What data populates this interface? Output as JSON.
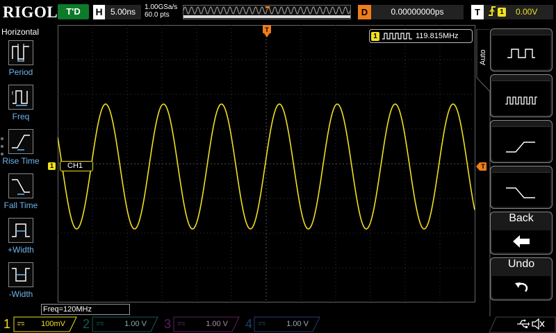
{
  "top": {
    "logo": "RIGOL",
    "run_status": "T'D",
    "h_badge": "H",
    "timebase": "5.00ns",
    "sample_rate": "1.00GSa/s",
    "memory_depth": "60.0 pts",
    "memory_trigger_badge": "T",
    "d_badge": "D",
    "delay": "0.00000000ps",
    "t_badge": "T",
    "trigger_edge": "rising-edge-icon",
    "trigger_source": "1",
    "trigger_level": "0.00V"
  },
  "left_menu": {
    "title": "Horizontal",
    "items": [
      {
        "label": "Period",
        "icon": "period-icon"
      },
      {
        "label": "Freq",
        "icon": "freq-icon"
      },
      {
        "label": "Rise Time",
        "icon": "rise-time-icon"
      },
      {
        "label": "Fall Time",
        "icon": "fall-time-icon"
      },
      {
        "label": "+Width",
        "icon": "plus-width-icon"
      },
      {
        "label": "-Width",
        "icon": "minus-width-icon"
      }
    ]
  },
  "display": {
    "ch1_marker": "1",
    "ch1_label": "CH1",
    "trigger_pos_marker": "T",
    "trigger_level_marker": "T",
    "freq_readout_badge": "1",
    "freq_readout": "119.815MHz",
    "freq_status": "Freq=120MHz",
    "colors": {
      "ch1": "#f0e020",
      "trigger": "#ee7d1b",
      "ch2": "#1fb8a8",
      "ch3": "#c23fd0",
      "ch4": "#3a7bd8"
    }
  },
  "right_menu": {
    "auto_label": "Auto",
    "keys": [
      {
        "name": "slow-square-wave-key",
        "icon": "slow-square-wave-icon"
      },
      {
        "name": "fast-square-wave-key",
        "icon": "fast-square-wave-icon"
      },
      {
        "name": "rising-edge-key",
        "icon": "rising-edge-icon"
      },
      {
        "name": "falling-edge-key",
        "icon": "falling-edge-icon"
      }
    ],
    "back_label": "Back",
    "back_icon": "back-arrow-icon",
    "undo_label": "Undo",
    "undo_icon": "undo-icon"
  },
  "bottom": {
    "channels": [
      {
        "num": "1",
        "scale": "100mV",
        "active": true
      },
      {
        "num": "2",
        "scale": "1.00 V",
        "active": false
      },
      {
        "num": "3",
        "scale": "1.00 V",
        "active": false
      },
      {
        "num": "4",
        "scale": "1.00 V",
        "active": false
      }
    ],
    "usb_icon": "usb-icon",
    "speaker_icon": "speaker-muted-icon"
  },
  "waveform": {
    "cycles": 7.2,
    "phase_deg": 152,
    "amplitude_divisions": 3.6
  }
}
